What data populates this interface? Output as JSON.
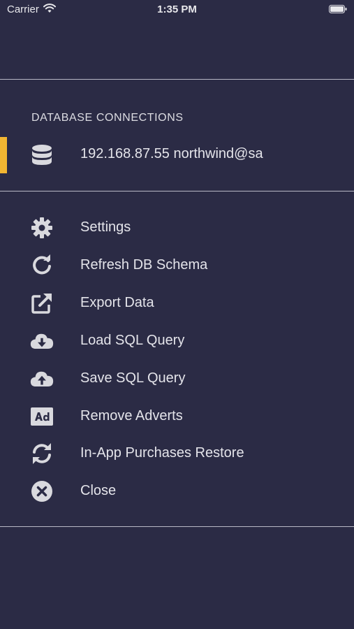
{
  "status_bar": {
    "carrier": "Carrier",
    "time": "1:35 PM",
    "wifi_icon": "wifi-icon",
    "battery_icon": "battery-icon"
  },
  "connections": {
    "header": "DATABASE CONNECTIONS",
    "items": [
      {
        "icon": "database-icon",
        "label": "192.168.87.55 northwind@sa",
        "active": true
      }
    ]
  },
  "menu": {
    "items": [
      {
        "icon": "gear-icon",
        "label": "Settings"
      },
      {
        "icon": "refresh-icon",
        "label": "Refresh DB Schema"
      },
      {
        "icon": "external-link-icon",
        "label": "Export Data"
      },
      {
        "icon": "cloud-download-icon",
        "label": "Load SQL Query"
      },
      {
        "icon": "cloud-upload-icon",
        "label": "Save SQL Query"
      },
      {
        "icon": "ad-icon",
        "label": "Remove Adverts"
      },
      {
        "icon": "sync-icon",
        "label": "In-App Purchases Restore"
      },
      {
        "icon": "close-circle-icon",
        "label": "Close"
      }
    ]
  },
  "colors": {
    "background": "#2b2b45",
    "accent": "#f2b632",
    "icon": "#d9d9de",
    "text": "#e4e4ea",
    "divider": "#b9b9c6"
  }
}
